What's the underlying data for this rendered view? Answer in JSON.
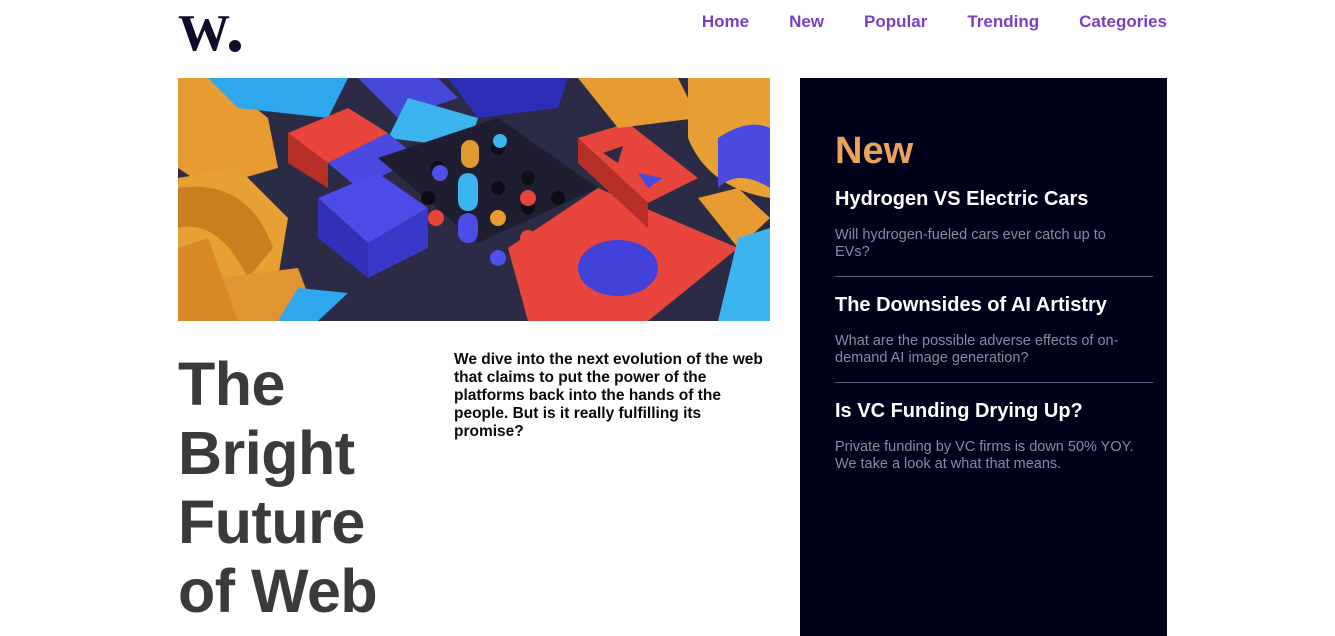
{
  "brand": {
    "logo_text": "W."
  },
  "nav": {
    "items": [
      {
        "label": "Home"
      },
      {
        "label": "New"
      },
      {
        "label": "Popular"
      },
      {
        "label": "Trending"
      },
      {
        "label": "Categories"
      }
    ]
  },
  "main": {
    "headline": [
      "The",
      "Bright",
      "Future",
      "of Web"
    ],
    "lede": "We dive into the next evolution of the web that claims to put the power of the platforms back into the hands of the people. But is it really fulfilling its promise?"
  },
  "sidebar": {
    "title": "New",
    "articles": [
      {
        "title": "Hydrogen VS Electric Cars",
        "summary": "Will hydrogen-fueled cars ever catch up to EVs?"
      },
      {
        "title": "The Downsides of AI Artistry",
        "summary": "What are the possible adverse effects of on-demand AI image generation?"
      },
      {
        "title": "Is VC Funding Drying Up?",
        "summary": "Private funding by VC firms is down 50% YOY. We take a look at what that means."
      }
    ]
  },
  "colors": {
    "nav_link": "#7b3fbf",
    "sidebar_bg": "#00001a",
    "sidebar_title": "#e9a35a",
    "headline": "#3a3a3a"
  }
}
